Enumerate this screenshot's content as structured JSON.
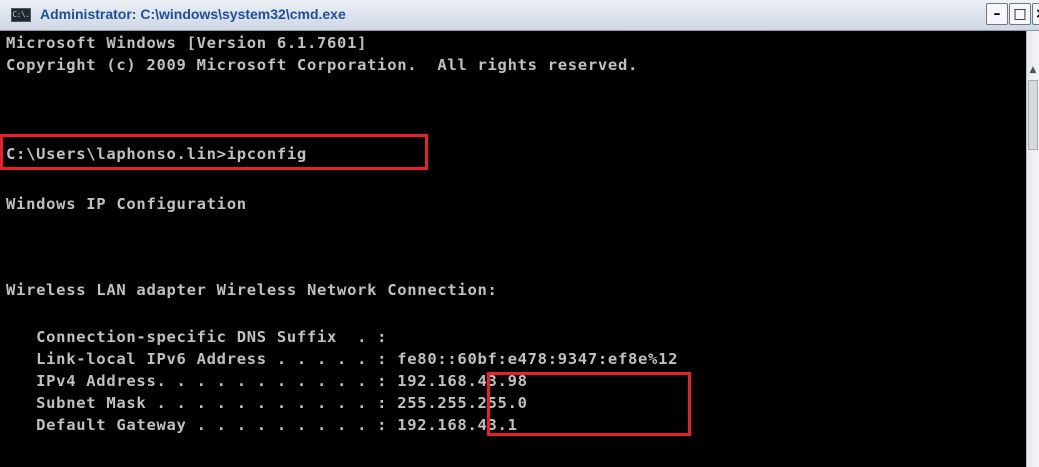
{
  "window": {
    "title": "Administrator: C:\\windows\\system32\\cmd.exe",
    "icon_label": "C:\\.",
    "minimize_glyph": "–",
    "maximize_glyph": "□",
    "close_glyph": "×"
  },
  "console": {
    "lines": [
      "Microsoft Windows [Version 6.1.7601]",
      "Copyright (c) 2009 Microsoft Corporation.  All rights reserved.",
      "C:\\Users\\laphonso.lin>ipconfig",
      "Windows IP Configuration",
      "Wireless LAN adapter Wireless Network Connection:",
      "   Connection-specific DNS Suffix  . :",
      "   Link-local IPv6 Address . . . . . : fe80::60bf:e478:9347:ef8e%12",
      "   IPv4 Address. . . . . . . . . . . : 192.168.43.98",
      "   Subnet Mask . . . . . . . . . . . : 255.255.255.0",
      "   Default Gateway . . . . . . . . . : 192.168.43.1"
    ]
  },
  "highlights": {
    "color": "#e8202a",
    "items": [
      "ipconfig-command",
      "ipv4-and-subnet-values"
    ]
  },
  "scroll_up_glyph": "▲"
}
